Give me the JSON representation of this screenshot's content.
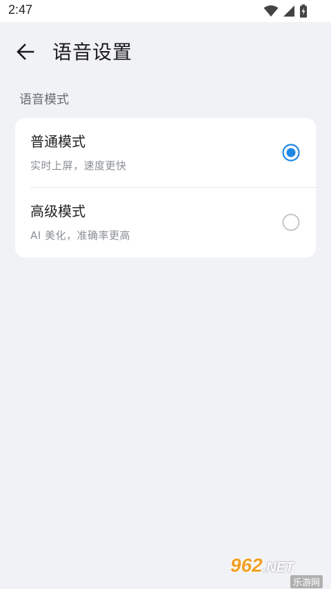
{
  "status_bar": {
    "time": "2:47",
    "icons": [
      "wifi-icon",
      "signal-icon",
      "battery-charging-icon"
    ]
  },
  "app_bar": {
    "back_icon": "arrow-left-icon",
    "title": "语音设置"
  },
  "section": {
    "title": "语音模式"
  },
  "options": [
    {
      "title": "普通模式",
      "description": "实时上屏，速度更快",
      "selected": true
    },
    {
      "title": "高级模式",
      "description": "AI 美化，准确率更高",
      "selected": false
    }
  ],
  "colors": {
    "accent": "#1e88e5",
    "background": "#f1f2f6",
    "card": "#ffffff",
    "radio_unselected": "#c4c6ca"
  },
  "watermark": {
    "brand": "962",
    "suffix": ".NET",
    "caption": "乐游网"
  }
}
